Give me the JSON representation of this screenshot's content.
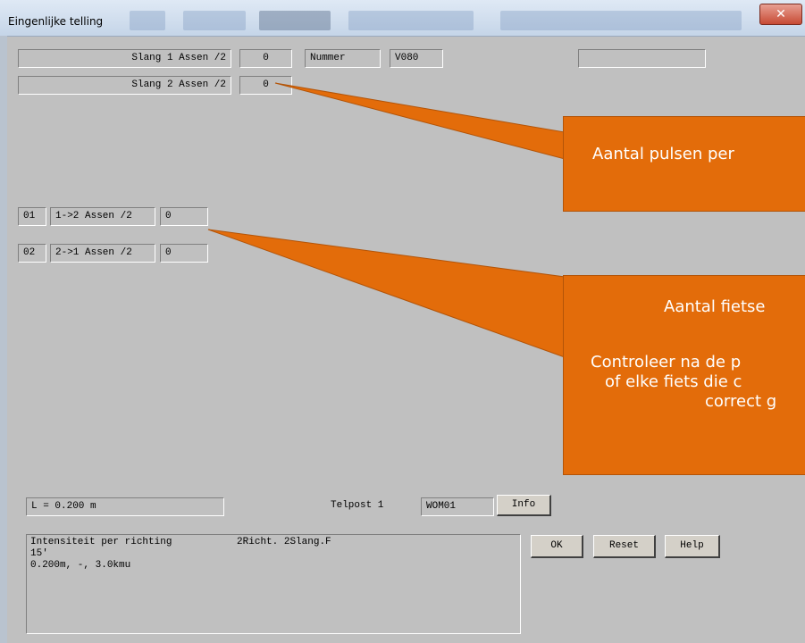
{
  "window": {
    "title": "Eingenlijke telling",
    "close_glyph": "✕"
  },
  "rows": {
    "slang1": {
      "label": "Slang 1 Assen /2",
      "value": "0",
      "nummer_label": "Nummer",
      "nummer_value": "V080",
      "extra_value": ""
    },
    "slang2": {
      "label": "Slang 2 Assen /2",
      "value": "0"
    }
  },
  "directions": [
    {
      "id": "01",
      "label": "1->2 Assen /2",
      "value": "0"
    },
    {
      "id": "02",
      "label": "2->1 Assen /2",
      "value": "0"
    }
  ],
  "bottom": {
    "length": "L = 0.200 m",
    "telpost_label": "Telpost 1",
    "telpost_value": "WOM01",
    "info_button": "Info"
  },
  "memo": {
    "lines": [
      "Intensiteit per richting           2Richt. 2Slang.F",
      "15'",
      "0.200m, -, 3.0kmu"
    ]
  },
  "buttons": {
    "ok": "OK",
    "reset": "Reset",
    "help": "Help"
  },
  "callouts": {
    "pulses": {
      "text": "Aantal pulsen per"
    },
    "bikes": {
      "lines": [
        "Aantal fietse",
        "",
        "Controleer na de p",
        "of elke fiets die c",
        "correct g"
      ]
    }
  },
  "colors": {
    "callout": "#e36c0a",
    "window_bg": "#c0c0c0",
    "close_button": "#c74a34"
  }
}
